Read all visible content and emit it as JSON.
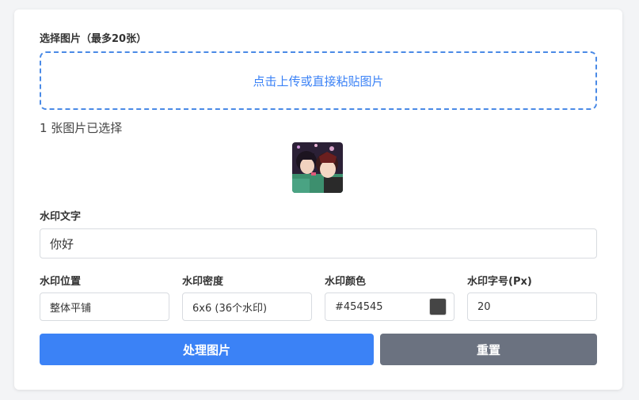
{
  "upload": {
    "label": "选择图片（最多20张）",
    "dropzone_text": "点击上传或直接粘贴图片",
    "selected_count_text": "1 张图片已选择"
  },
  "watermark_text": {
    "label": "水印文字",
    "value": "你好"
  },
  "options": {
    "position": {
      "label": "水印位置",
      "value": "整体平铺"
    },
    "density": {
      "label": "水印密度",
      "value": "6x6 (36个水印)"
    },
    "color": {
      "label": "水印颜色",
      "value": "#454545",
      "swatch": "#454545"
    },
    "font_size": {
      "label": "水印字号(Px)",
      "value": "20"
    }
  },
  "actions": {
    "process_label": "处理图片",
    "reset_label": "重置"
  },
  "colors": {
    "accent": "#3b82f6",
    "reset": "#6b7280"
  }
}
